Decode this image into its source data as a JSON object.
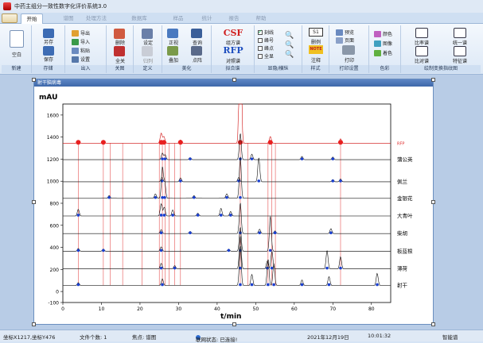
{
  "window": {
    "title": "中药主组分一致性数字化评价系统3.0"
  },
  "tabs": [
    "开始",
    "谱图",
    "处理方法",
    "数据库",
    "样品",
    "统计",
    "报告",
    "帮助"
  ],
  "ribbon": {
    "groups": [
      {
        "name": "新建",
        "big": [
          {
            "label": "空白"
          }
        ]
      },
      {
        "name": "存储",
        "big": [
          {
            "label": "另存"
          },
          {
            "label": "保存"
          }
        ]
      },
      {
        "name": "出入",
        "small": [
          "导出",
          "导入",
          "粘贴",
          "设置"
        ]
      },
      {
        "name": "关图",
        "big": [
          {
            "label": "删除"
          },
          {
            "label": "全关"
          }
        ]
      },
      {
        "name": "定义",
        "big": [
          {
            "label": "设定"
          },
          {
            "label": "归列"
          }
        ]
      },
      {
        "name": "美化",
        "big": [
          {
            "label": "正视"
          },
          {
            "label": "查询"
          },
          {
            "label": "叠加"
          },
          {
            "label": "点阵"
          }
        ]
      },
      {
        "name": "拟合谱",
        "big": [
          {
            "label": "组方谱",
            "mark": "CSF"
          },
          {
            "label": "对照谱",
            "mark": "RFP"
          }
        ]
      },
      {
        "name": "显隐/横纵",
        "checks": [
          {
            "label": "刻线",
            "on": true
          },
          {
            "label": "峰号",
            "on": false
          },
          {
            "label": "峰点",
            "on": false
          },
          {
            "label": "全显",
            "on": false
          }
        ]
      },
      {
        "name": "样式",
        "big": [
          {
            "label": "删例",
            "mark": "S1"
          },
          {
            "label": "注释",
            "mark": "NOTE"
          }
        ]
      },
      {
        "name": "打印设置",
        "small": [
          "预览",
          "页面"
        ],
        "big": [
          {
            "label": "打印"
          }
        ]
      },
      {
        "name": "色彩",
        "small": [
          "颜色",
          "图像",
          "着色"
        ]
      },
      {
        "name": "绘制变换指纹图",
        "big": [
          {
            "label": "比率谱"
          },
          {
            "label": "统一谱"
          },
          {
            "label": "比对谱"
          },
          {
            "label": "特征谱"
          }
        ]
      }
    ]
  },
  "chart_window": {
    "title": "射干脑病毒"
  },
  "chart_data": {
    "type": "line",
    "title": "",
    "xlabel": "t/min",
    "ylabel": "mAU",
    "xlim": [
      0,
      85
    ],
    "ylim": [
      -100,
      1700
    ],
    "xticks": [
      0,
      10,
      20,
      30,
      40,
      50,
      60,
      70,
      80
    ],
    "yticks": [
      -100,
      0,
      200,
      400,
      600,
      800,
      1000,
      1200,
      1400,
      1600
    ],
    "marker_x": [
      4,
      10.5,
      12.3,
      15.5,
      20.5,
      25,
      25.8,
      26.5,
      27.5,
      29,
      30.5,
      46,
      48,
      53.2,
      54.2,
      55.1,
      72
    ],
    "series": [
      {
        "name": "RFP",
        "baseline": 1345,
        "peaks": [
          [
            46,
            2100
          ],
          [
            25.5,
            90
          ],
          [
            26.2,
            60
          ],
          [
            53.8,
            60
          ],
          [
            72,
            40
          ],
          [
            10.5,
            25
          ],
          [
            4,
            20
          ],
          [
            30.5,
            30
          ]
        ]
      },
      {
        "name": "蒲公英",
        "baseline": 1195,
        "peaks": [
          [
            46,
            240
          ],
          [
            25.8,
            60
          ],
          [
            26.5,
            45
          ],
          [
            49,
            50
          ],
          [
            62,
            30
          ],
          [
            70,
            25
          ],
          [
            33,
            20
          ]
        ]
      },
      {
        "name": "佩兰",
        "baseline": 995,
        "peaks": [
          [
            50.8,
            220
          ],
          [
            45.6,
            40
          ],
          [
            25.7,
            40
          ],
          [
            30.5,
            35
          ],
          [
            70,
            20
          ],
          [
            72,
            25
          ]
        ]
      },
      {
        "name": "金银花",
        "baseline": 845,
        "peaks": [
          [
            46,
            380
          ],
          [
            25.8,
            280
          ],
          [
            26.4,
            150
          ],
          [
            42.5,
            40
          ],
          [
            24,
            40
          ],
          [
            12,
            25
          ],
          [
            34,
            25
          ]
        ]
      },
      {
        "name": "大青叶",
        "baseline": 685,
        "peaks": [
          [
            25.5,
            110
          ],
          [
            26.3,
            80
          ],
          [
            4,
            60
          ],
          [
            41,
            70
          ],
          [
            43.5,
            40
          ],
          [
            28.5,
            55
          ],
          [
            35,
            25
          ]
        ]
      },
      {
        "name": "柴胡",
        "baseline": 525,
        "peaks": [
          [
            46,
            280
          ],
          [
            51,
            40
          ],
          [
            69.5,
            45
          ],
          [
            55,
            25
          ],
          [
            25.5,
            35
          ],
          [
            33,
            20
          ]
        ]
      },
      {
        "name": "板蓝根",
        "baseline": 365,
        "peaks": [
          [
            46,
            220
          ],
          [
            53.8,
            320
          ],
          [
            25.5,
            40
          ],
          [
            4,
            25
          ],
          [
            10.5,
            20
          ],
          [
            43,
            20
          ]
        ]
      },
      {
        "name": "薄荷",
        "baseline": 205,
        "peaks": [
          [
            46,
            300
          ],
          [
            54.2,
            160
          ],
          [
            68.5,
            170
          ],
          [
            72,
            110
          ],
          [
            53,
            70
          ],
          [
            25.5,
            50
          ],
          [
            29,
            30
          ]
        ]
      },
      {
        "name": "射干",
        "baseline": 55,
        "peaks": [
          [
            46,
            360
          ],
          [
            53.2,
            240
          ],
          [
            54.7,
            200
          ],
          [
            49,
            100
          ],
          [
            69,
            80
          ],
          [
            62,
            50
          ],
          [
            25.8,
            60
          ],
          [
            4,
            25
          ],
          [
            81.5,
            110
          ]
        ]
      }
    ]
  },
  "status": {
    "coords": "坐标X1217,坐标Y476",
    "files": "文件个数: 1",
    "focus": "焦点: 谱图",
    "network": "联网状态: 已连接!",
    "date": "2021年12月19日",
    "time": "10:01:32",
    "mode": "智能谱"
  }
}
